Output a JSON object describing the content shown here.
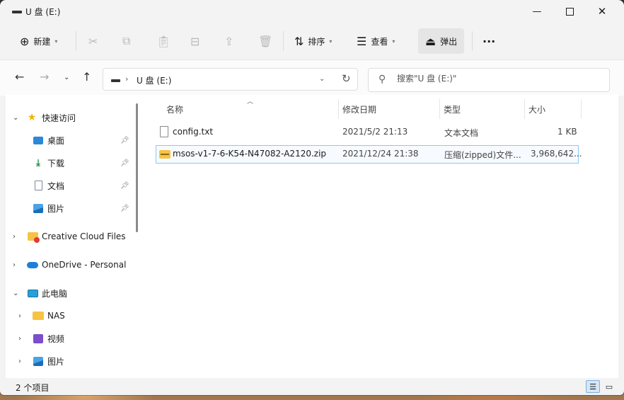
{
  "window": {
    "title": "U 盘 (E:)"
  },
  "toolbar": {
    "new_label": "新建",
    "sort_label": "排序",
    "view_label": "查看",
    "eject_label": "弹出",
    "more_label": "···"
  },
  "address": {
    "separator": "›",
    "path": "U 盘 (E:)"
  },
  "search": {
    "placeholder": "搜索\"U 盘 (E:)\""
  },
  "nav": {
    "quick_access": "快速访问",
    "desktop": "桌面",
    "downloads": "下载",
    "documents": "文档",
    "pictures": "图片",
    "creative_cloud": "Creative Cloud Files",
    "onedrive": "OneDrive - Personal",
    "this_pc": "此电脑",
    "nas": "NAS",
    "videos": "视频",
    "pictures2": "图片"
  },
  "columns": {
    "name": "名称",
    "date": "修改日期",
    "type": "类型",
    "size": "大小"
  },
  "files": [
    {
      "name": "config.txt",
      "date": "2021/5/2 21:13",
      "type": "文本文档",
      "size": "1 KB"
    },
    {
      "name": "msos-v1-7-6-K54-N47082-A2120.zip",
      "date": "2021/12/24 21:38",
      "type": "压缩(zipped)文件...",
      "size": "3,968,642..."
    }
  ],
  "status": {
    "count": "2 个项目"
  }
}
